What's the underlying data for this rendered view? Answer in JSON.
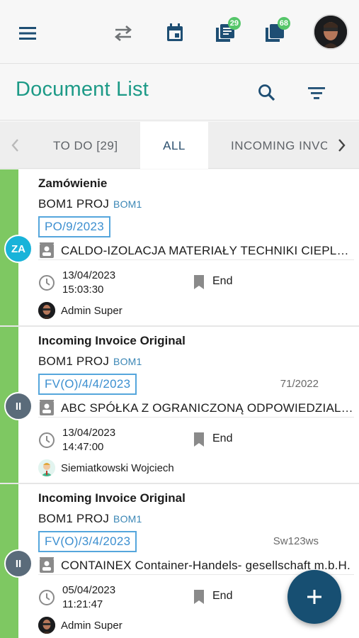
{
  "header": {
    "menu_icon": "hamburger-menu-icon",
    "swap_icon": "swap-arrows-icon",
    "calendar_icon": "calendar-icon",
    "documents_badge": "29",
    "files_badge": "68"
  },
  "title": "Document List",
  "tabs": {
    "todo": "TO DO [29]",
    "all": "ALL",
    "incoming": "INCOMING INVC"
  },
  "documents": [
    {
      "status_label": "ZA",
      "title": "Zamówienie",
      "project": "BOM1 PROJ",
      "project_code": "BOM1",
      "number": "PO/9/2023",
      "reference": "",
      "contractor": "CALDO-IZOLACJA MATERIAŁY TECHNIKI CIEPLNEJ",
      "date": "13/04/2023",
      "time": "15:03:30",
      "stage": "End",
      "user": "Admin Super"
    },
    {
      "status_label": "II",
      "title": "Incoming Invoice Original",
      "project": "BOM1 PROJ",
      "project_code": "BOM1",
      "number": "FV(O)/4/4/2023",
      "reference": "71/2022",
      "contractor": "ABC SPÓŁKA Z OGRANICZONĄ ODPOWIEDZIALNOŚCIĄ",
      "date": "13/04/2023",
      "time": "14:47:00",
      "stage": "End",
      "user": "Siemiatkowski Wojciech"
    },
    {
      "status_label": "II",
      "title": "Incoming Invoice Original",
      "project": "BOM1 PROJ",
      "project_code": "BOM1",
      "number": "FV(O)/3/4/2023",
      "reference": "Sw123ws",
      "contractor": "CONTAINEX Container-Handels- gesellschaft m.b.H.",
      "date": "05/04/2023",
      "time": "11:21:47",
      "stage": "End",
      "user": "Admin Super"
    }
  ],
  "colors": {
    "accent": "#1d9a87",
    "stripe": "#7ec862",
    "fab": "#174f72",
    "doc_number": "#3c8fd0"
  }
}
